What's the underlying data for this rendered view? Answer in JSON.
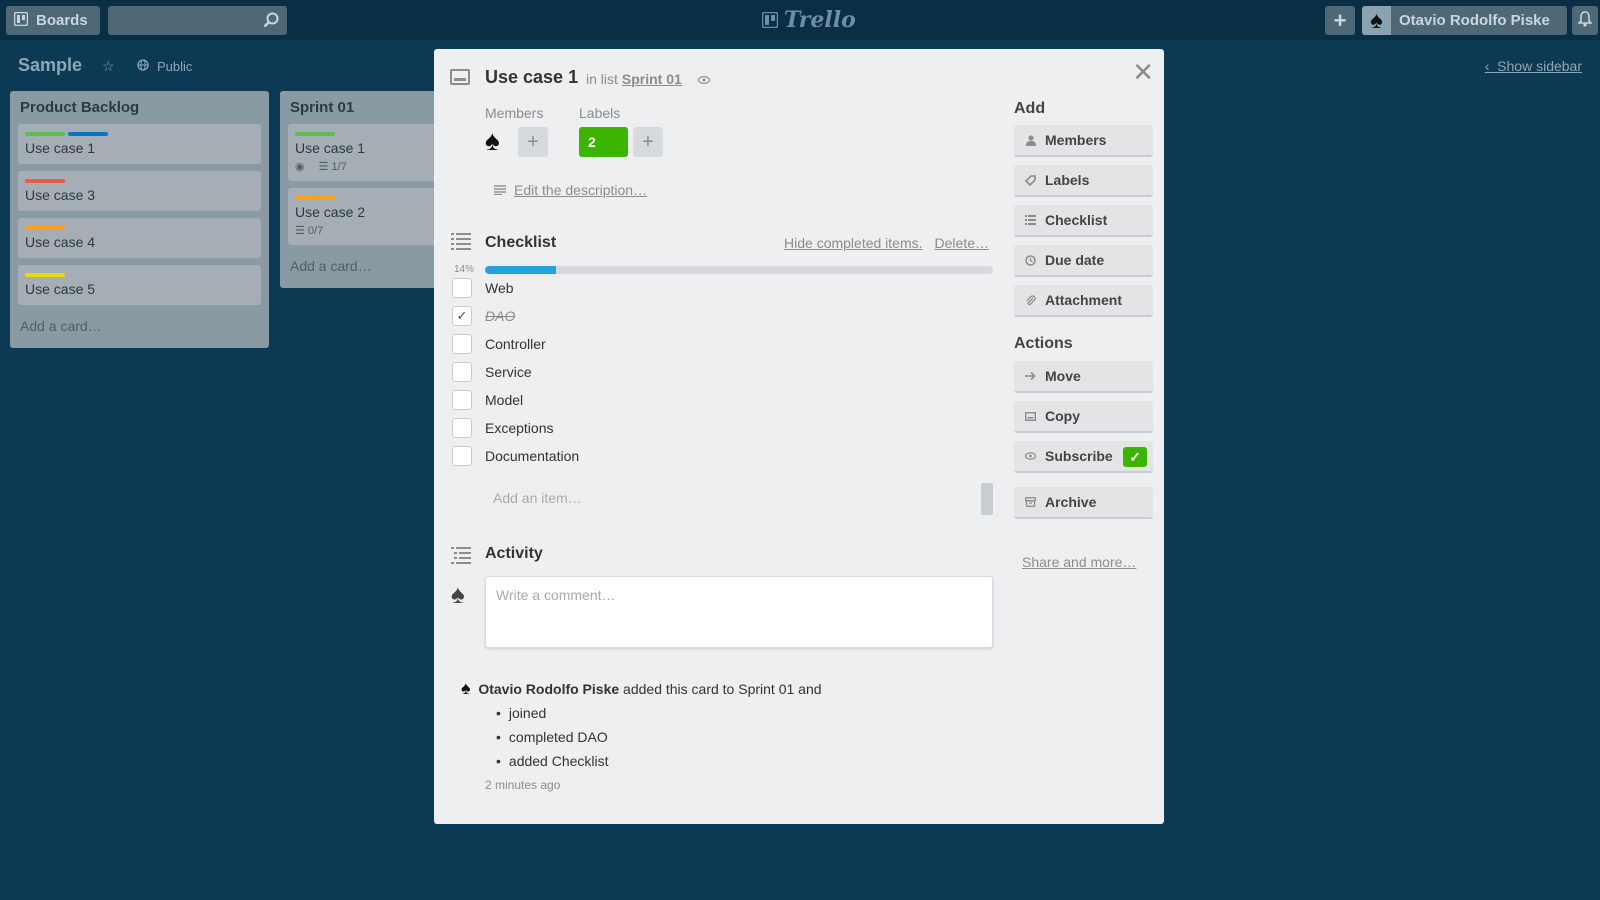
{
  "topbar": {
    "boards_label": "Boards",
    "search_placeholder": "",
    "logo_text": "Trello",
    "user_name": "Otavio Rodolfo Piske"
  },
  "board": {
    "title": "Sample",
    "visibility": "Public",
    "show_sidebar": "Show sidebar",
    "lists": [
      {
        "title": "Product Backlog",
        "cards": [
          {
            "title": "Use case 1",
            "labels": [
              "#61bd4f",
              "#0079bf"
            ]
          },
          {
            "title": "Use case 3",
            "labels": [
              "#eb5a46"
            ]
          },
          {
            "title": "Use case 4",
            "labels": [
              "#ff9f1a"
            ]
          },
          {
            "title": "Use case 5",
            "labels": [
              "#f2d600"
            ]
          }
        ],
        "add_card": "Add a card…"
      },
      {
        "title": "Sprint 01",
        "cards": [
          {
            "title": "Use case 1",
            "labels": [
              "#61bd4f"
            ],
            "checklist": "1/7"
          },
          {
            "title": "Use case 2",
            "labels": [
              "#ff9f1a"
            ],
            "checklist": "0/7"
          }
        ],
        "add_card": "Add a card…"
      }
    ]
  },
  "card": {
    "title": "Use case 1",
    "in_list_prefix": "in list",
    "list_name": "Sprint 01",
    "members_heading": "Members",
    "labels_heading": "Labels",
    "label_value": "2",
    "label_color": "#3cb500",
    "edit_description": "Edit the description…",
    "checklist": {
      "title": "Checklist",
      "hide_completed": "Hide completed items.",
      "delete": "Delete…",
      "percent_label": "14%",
      "progress": 0.14,
      "items": [
        {
          "text": "Web",
          "done": false
        },
        {
          "text": "DAO",
          "done": true
        },
        {
          "text": "Controller",
          "done": false
        },
        {
          "text": "Service",
          "done": false
        },
        {
          "text": "Model",
          "done": false
        },
        {
          "text": "Exceptions",
          "done": false
        },
        {
          "text": "Documentation",
          "done": false
        }
      ],
      "add_item_placeholder": "Add an item…"
    },
    "activity": {
      "title": "Activity",
      "comment_placeholder": "Write a comment…",
      "entry": {
        "user": "Otavio Rodolfo Piske",
        "text": "added this card to Sprint 01 and",
        "details": [
          "joined",
          "completed DAO",
          "added Checklist"
        ],
        "time": "2 minutes ago"
      }
    }
  },
  "sidebar": {
    "add_heading": "Add",
    "add_buttons": [
      {
        "label": "Members",
        "icon": "person-icon"
      },
      {
        "label": "Labels",
        "icon": "tag-icon"
      },
      {
        "label": "Checklist",
        "icon": "checklist-icon"
      },
      {
        "label": "Due date",
        "icon": "clock-icon"
      },
      {
        "label": "Attachment",
        "icon": "paperclip-icon"
      }
    ],
    "actions_heading": "Actions",
    "action_buttons": [
      {
        "label": "Move",
        "icon": "arrow-right-icon"
      },
      {
        "label": "Copy",
        "icon": "copy-icon"
      },
      {
        "label": "Subscribe",
        "icon": "eye-icon",
        "checked": true
      },
      {
        "label": "Archive",
        "icon": "archive-icon"
      }
    ],
    "share": "Share and more…"
  },
  "colors": {
    "board_bg": "#0c3953",
    "progress": "#24a1de",
    "green": "#3cb500"
  }
}
